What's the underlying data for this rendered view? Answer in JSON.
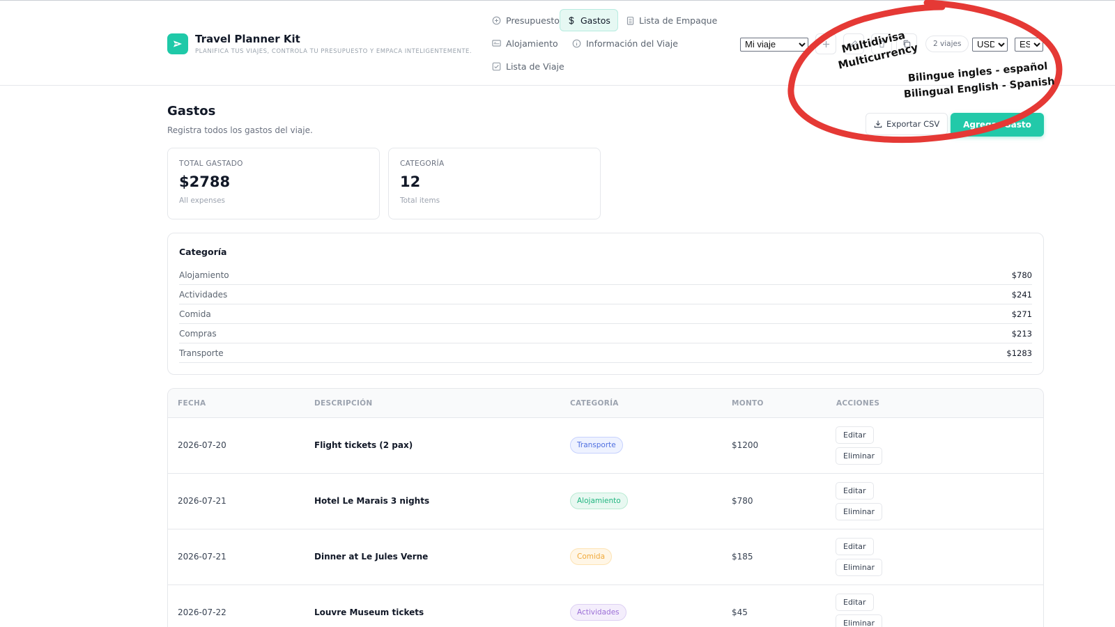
{
  "app": {
    "title": "Travel Planner Kit",
    "subtitle": "PLANIFICA TUS VIAJES, CONTROLA TU PRESUPUESTO Y EMPACA INTELIGENTEMENTE.",
    "accent_color": "#1fc9a8",
    "logo_icon": "plane-icon"
  },
  "nav": {
    "items": [
      {
        "label": "Presupuesto",
        "icon": "plus-circle-icon",
        "active": false
      },
      {
        "label": "Gastos",
        "icon": "dollar-icon",
        "active": true
      },
      {
        "label": "Lista de Empaque",
        "icon": "clipboard-icon",
        "active": false
      },
      {
        "label": "Alojamiento",
        "icon": "bed-icon",
        "active": false
      },
      {
        "label": "Información del Viaje",
        "icon": "info-icon",
        "active": false
      },
      {
        "label": "Lista de Viaje",
        "icon": "checkbox-icon",
        "active": false
      }
    ]
  },
  "controls": {
    "trip_select": "Mi viaje",
    "trips_count": "2 viajes",
    "currency": "USD",
    "language": "ES"
  },
  "page": {
    "title": "Gastos",
    "subtitle": "Registra todos los gastos del viaje.",
    "export_label": "Exportar CSV",
    "add_label": "Agregar Gasto"
  },
  "stats": [
    {
      "label": "TOTAL GASTADO",
      "value": "$2788",
      "note": "All expenses"
    },
    {
      "label": "CATEGORÍA",
      "value": "12",
      "note": "Total items"
    }
  ],
  "categories": {
    "title": "Categoría",
    "rows": [
      {
        "name": "Alojamiento",
        "amount": "$780"
      },
      {
        "name": "Actividades",
        "amount": "$241"
      },
      {
        "name": "Comida",
        "amount": "$271"
      },
      {
        "name": "Compras",
        "amount": "$213"
      },
      {
        "name": "Transporte",
        "amount": "$1283"
      }
    ]
  },
  "table": {
    "headers": [
      "FECHA",
      "DESCRIPCIÓN",
      "CATEGORÍA",
      "MONTO",
      "ACCIONES"
    ],
    "edit_label": "Editar",
    "delete_label": "Eliminar",
    "rows": [
      {
        "date": "2026-07-20",
        "description": "Flight tickets (2 pax)",
        "category": "Transporte",
        "amount": "$1200",
        "badge_color": "#4f6fe0"
      },
      {
        "date": "2026-07-21",
        "description": "Hotel Le Marais 3 nights",
        "category": "Alojamiento",
        "amount": "$780",
        "badge_color": "#1fb57f"
      },
      {
        "date": "2026-07-21",
        "description": "Dinner at Le Jules Verne",
        "category": "Comida",
        "amount": "$185",
        "badge_color": "#f0a93a"
      },
      {
        "date": "2026-07-22",
        "description": "Louvre Museum tickets",
        "category": "Actividades",
        "amount": "$45",
        "badge_color": "#9b6fd6"
      }
    ]
  },
  "annotation": {
    "color": "#e53935",
    "line1": "Multidivisa",
    "line2": "Multicurrency",
    "line3": "Bilingue ingles - español",
    "line4": "Bilingual English - Spanish"
  }
}
